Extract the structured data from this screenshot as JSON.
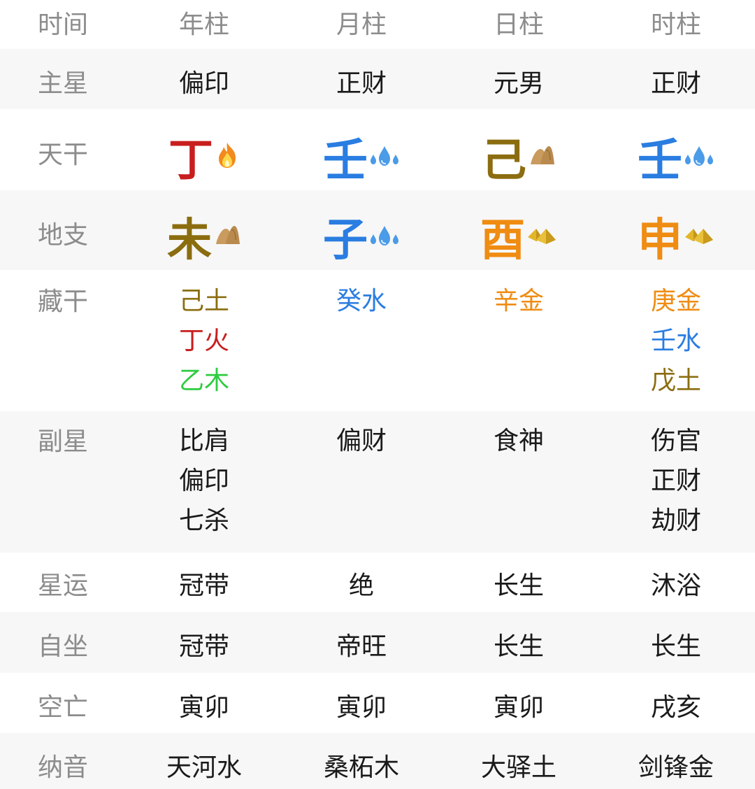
{
  "colors": {
    "fire": "#c81e1e",
    "water": "#2a7de1",
    "earth": "#8b6d10",
    "metal": "#ef8c12",
    "wood": "#2ecc40",
    "label": "#8c8c8c",
    "text": "#1a1a1a",
    "row_alt": "#f7f7f7"
  },
  "header": {
    "label": "时间",
    "columns": [
      "年柱",
      "月柱",
      "日柱",
      "时柱"
    ]
  },
  "rows": {
    "main_star": {
      "label": "主星",
      "values": [
        "偏印",
        "正财",
        "元男",
        "正财"
      ]
    },
    "heavenly_stem": {
      "label": "天干",
      "values": [
        {
          "char": "丁",
          "element": "fire",
          "icon": "fire-icon"
        },
        {
          "char": "壬",
          "element": "water",
          "icon": "water-drops-icon"
        },
        {
          "char": "己",
          "element": "earth",
          "icon": "earth-mound-icon"
        },
        {
          "char": "壬",
          "element": "water",
          "icon": "water-drops-icon"
        }
      ]
    },
    "earthly_branch": {
      "label": "地支",
      "values": [
        {
          "char": "未",
          "element": "earth",
          "icon": "earth-mound-icon"
        },
        {
          "char": "子",
          "element": "water",
          "icon": "water-drops-icon"
        },
        {
          "char": "酉",
          "element": "metal",
          "icon": "gold-pyramid-icon"
        },
        {
          "char": "申",
          "element": "metal",
          "icon": "gold-pyramid-icon"
        }
      ]
    },
    "hidden_stems": {
      "label": "藏干",
      "values": [
        [
          {
            "text": "己土",
            "element": "earth"
          },
          {
            "text": "丁火",
            "element": "fire"
          },
          {
            "text": "乙木",
            "element": "wood"
          }
        ],
        [
          {
            "text": "癸水",
            "element": "water"
          }
        ],
        [
          {
            "text": "辛金",
            "element": "metal"
          }
        ],
        [
          {
            "text": "庚金",
            "element": "metal"
          },
          {
            "text": "壬水",
            "element": "water"
          },
          {
            "text": "戊土",
            "element": "earth"
          }
        ]
      ]
    },
    "sub_stars": {
      "label": "副星",
      "values": [
        [
          "比肩",
          "偏印",
          "七杀"
        ],
        [
          "偏财"
        ],
        [
          "食神"
        ],
        [
          "伤官",
          "正财",
          "劫财"
        ]
      ]
    },
    "star_fortune": {
      "label": "星运",
      "values": [
        "冠带",
        "绝",
        "长生",
        "沐浴"
      ]
    },
    "self_seat": {
      "label": "自坐",
      "values": [
        "冠带",
        "帝旺",
        "长生",
        "长生"
      ]
    },
    "void": {
      "label": "空亡",
      "values": [
        "寅卯",
        "寅卯",
        "寅卯",
        "戌亥"
      ]
    },
    "nayin": {
      "label": "纳音",
      "values": [
        "天河水",
        "桑柘木",
        "大驿土",
        "剑锋金"
      ]
    }
  }
}
